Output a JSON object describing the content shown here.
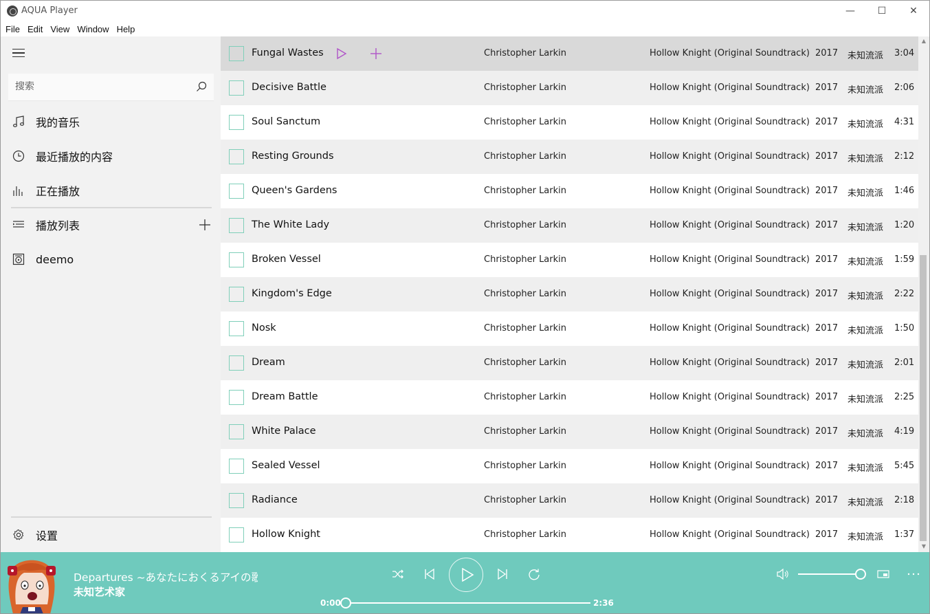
{
  "window": {
    "title": "AQUA Player",
    "minimize_glyph": "—",
    "maximize_glyph": "☐",
    "close_glyph": "✕"
  },
  "menu": [
    "File",
    "Edit",
    "View",
    "Window",
    "Help"
  ],
  "sidebar": {
    "search_placeholder": "搜索",
    "items": [
      {
        "label": "我的音乐",
        "icon": "music-note-icon"
      },
      {
        "label": "最近播放的内容",
        "icon": "clock-icon"
      },
      {
        "label": "正在播放",
        "icon": "equalizer-bars-icon"
      },
      {
        "label": "播放列表",
        "icon": "playlist-icon"
      },
      {
        "label": "deemo",
        "icon": "playlist-disc-icon"
      }
    ],
    "settings_label": "设置"
  },
  "tracks": [
    {
      "title": "Fungal Wastes",
      "artist": "Christopher Larkin",
      "album": "Hollow Knight (Original Soundtrack)",
      "year": "2017",
      "genre": "未知流派",
      "duration": "3:04"
    },
    {
      "title": "Decisive Battle",
      "artist": "Christopher Larkin",
      "album": "Hollow Knight (Original Soundtrack)",
      "year": "2017",
      "genre": "未知流派",
      "duration": "2:06"
    },
    {
      "title": "Soul Sanctum",
      "artist": "Christopher Larkin",
      "album": "Hollow Knight (Original Soundtrack)",
      "year": "2017",
      "genre": "未知流派",
      "duration": "4:31"
    },
    {
      "title": "Resting Grounds",
      "artist": "Christopher Larkin",
      "album": "Hollow Knight (Original Soundtrack)",
      "year": "2017",
      "genre": "未知流派",
      "duration": "2:12"
    },
    {
      "title": "Queen's Gardens",
      "artist": "Christopher Larkin",
      "album": "Hollow Knight (Original Soundtrack)",
      "year": "2017",
      "genre": "未知流派",
      "duration": "1:46"
    },
    {
      "title": "The White Lady",
      "artist": "Christopher Larkin",
      "album": "Hollow Knight (Original Soundtrack)",
      "year": "2017",
      "genre": "未知流派",
      "duration": "1:20"
    },
    {
      "title": "Broken Vessel",
      "artist": "Christopher Larkin",
      "album": "Hollow Knight (Original Soundtrack)",
      "year": "2017",
      "genre": "未知流派",
      "duration": "1:59"
    },
    {
      "title": "Kingdom's Edge",
      "artist": "Christopher Larkin",
      "album": "Hollow Knight (Original Soundtrack)",
      "year": "2017",
      "genre": "未知流派",
      "duration": "2:22"
    },
    {
      "title": "Nosk",
      "artist": "Christopher Larkin",
      "album": "Hollow Knight (Original Soundtrack)",
      "year": "2017",
      "genre": "未知流派",
      "duration": "1:50"
    },
    {
      "title": "Dream",
      "artist": "Christopher Larkin",
      "album": "Hollow Knight (Original Soundtrack)",
      "year": "2017",
      "genre": "未知流派",
      "duration": "2:01"
    },
    {
      "title": "Dream Battle",
      "artist": "Christopher Larkin",
      "album": "Hollow Knight (Original Soundtrack)",
      "year": "2017",
      "genre": "未知流派",
      "duration": "2:25"
    },
    {
      "title": "White Palace",
      "artist": "Christopher Larkin",
      "album": "Hollow Knight (Original Soundtrack)",
      "year": "2017",
      "genre": "未知流派",
      "duration": "4:19"
    },
    {
      "title": "Sealed Vessel",
      "artist": "Christopher Larkin",
      "album": "Hollow Knight (Original Soundtrack)",
      "year": "2017",
      "genre": "未知流派",
      "duration": "5:45"
    },
    {
      "title": "Radiance",
      "artist": "Christopher Larkin",
      "album": "Hollow Knight (Original Soundtrack)",
      "year": "2017",
      "genre": "未知流派",
      "duration": "2:18"
    },
    {
      "title": "Hollow Knight",
      "artist": "Christopher Larkin",
      "album": "Hollow Knight (Original Soundtrack)",
      "year": "2017",
      "genre": "未知流派",
      "duration": "1:37"
    }
  ],
  "hovered_track_index": 0,
  "player": {
    "song_title": "Departures ~あなたにおくるアイの歌",
    "song_artist": "未知艺术家",
    "time_current": "0:00",
    "time_total": "2:36",
    "progress": 0.0,
    "volume": 1.0
  },
  "colors": {
    "accent": "#6fcabd",
    "checkbox_border": "#7fcfb9",
    "row_action": "#b054c8"
  }
}
